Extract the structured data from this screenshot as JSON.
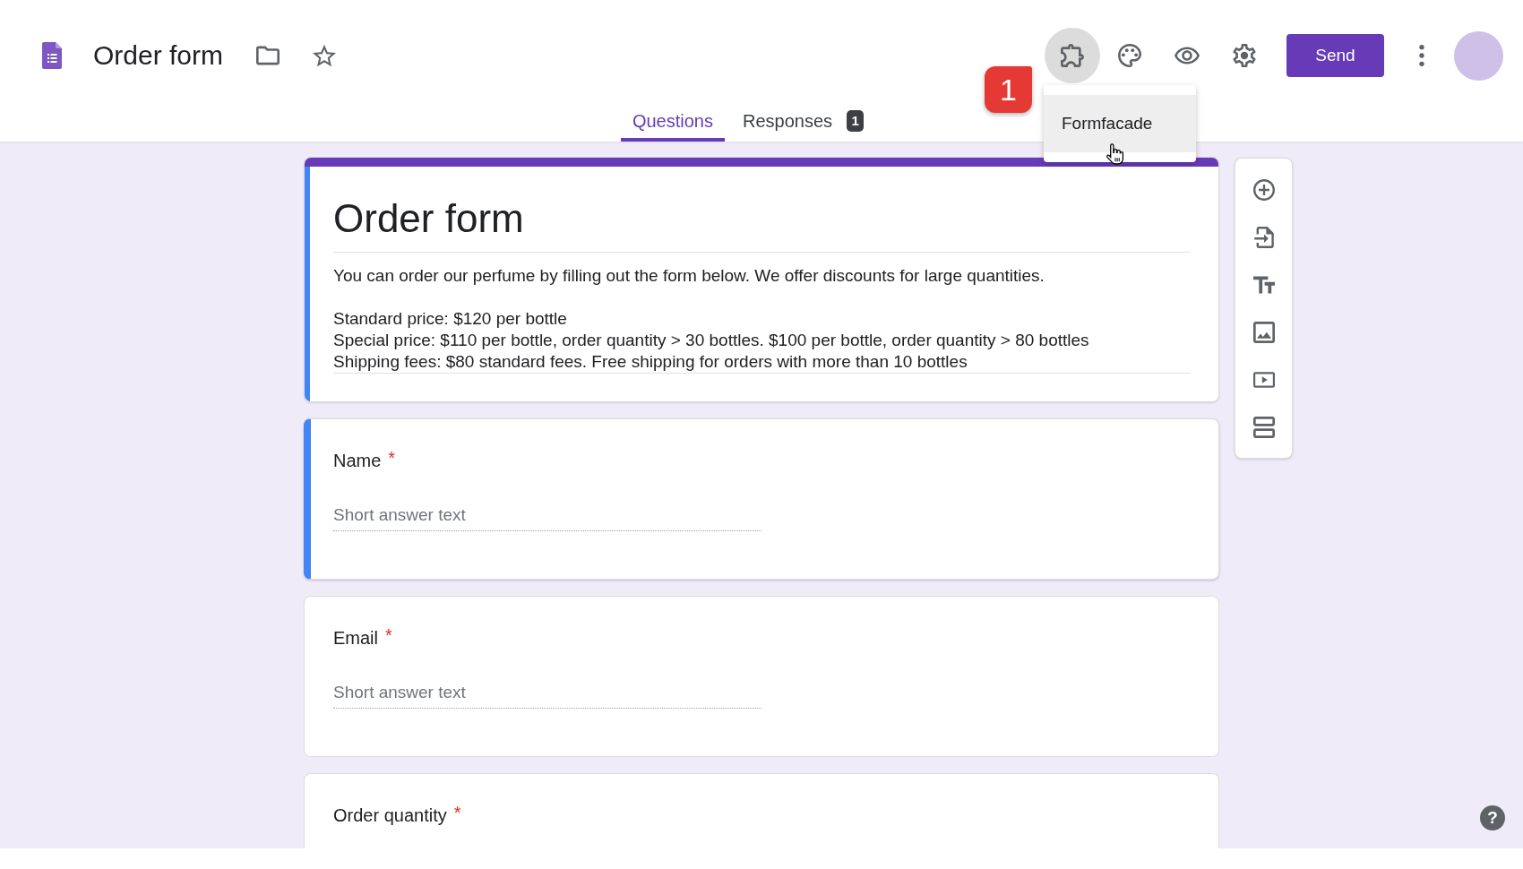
{
  "app_bar": {
    "title": "Order form",
    "send_label": "Send"
  },
  "addon_menu": {
    "open": true,
    "items": [
      {
        "label": "Formfacade",
        "highlighted": true
      }
    ]
  },
  "callout": {
    "label": "1"
  },
  "tabs": [
    {
      "label": "Questions",
      "selected": true
    },
    {
      "label": "Responses",
      "selected": false,
      "count": "1"
    }
  ],
  "form_header": {
    "title": "Order form",
    "description": "You can order our perfume by filling out the form below. We offer discounts for large quantities.\n\nStandard price: $120 per bottle\nSpecial price: $110 per bottle, order quantity > 30 bottles. $100 per bottle, order quantity > 80 bottles\nShipping fees: $80 standard fees. Free shipping for orders with more than 10 bottles",
    "selected": true
  },
  "questions": [
    {
      "title": "Name",
      "required_mark": "*",
      "placeholder": "Short answer text",
      "selected": true
    },
    {
      "title": "Email",
      "required_mark": "*",
      "placeholder": "Short answer text",
      "selected": false
    },
    {
      "title": "Order quantity",
      "required_mark": "*",
      "selected": false
    }
  ],
  "help": {
    "label": "?"
  }
}
